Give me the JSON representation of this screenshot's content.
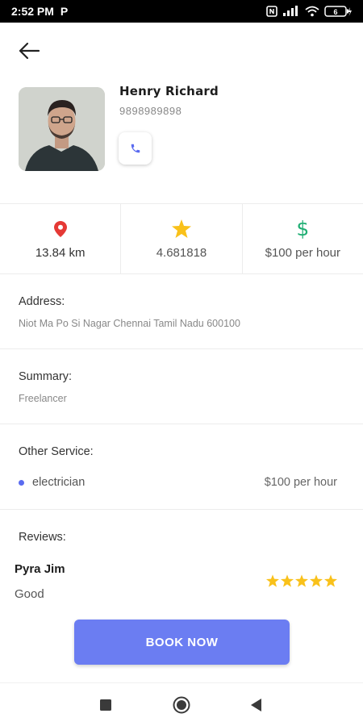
{
  "status_bar": {
    "time": "2:52 PM",
    "app_indicator": "P",
    "icons": [
      "nfc-icon",
      "signal-icon",
      "wifi-icon",
      "battery-icon"
    ],
    "battery_level": "6"
  },
  "header": {
    "back_icon": "arrow-left-icon"
  },
  "provider": {
    "name": "Henry Richard",
    "phone": "9898989898",
    "call_icon": "phone-icon"
  },
  "stats": {
    "distance": "13.84 km",
    "rating": "4.681818",
    "price": "$100 per hour",
    "distance_icon": "location-pin-icon",
    "rating_icon": "star-icon",
    "price_icon": "dollar-icon",
    "colors": {
      "location": "#e53935",
      "star": "#f9c11a",
      "dollar": "#1fae73"
    }
  },
  "address": {
    "title": "Address:",
    "value": "Niot Ma Po Si Nagar Chennai Tamil Nadu 600100"
  },
  "summary": {
    "title": "Summary:",
    "value": "Freelancer"
  },
  "other_service": {
    "title": "Other Service:",
    "items": [
      {
        "name": "electrician",
        "price": "$100 per hour"
      }
    ]
  },
  "reviews": {
    "title": "Reviews:",
    "items": [
      {
        "author": "Pyra Jim",
        "text": "Good",
        "stars": 5
      }
    ]
  },
  "cta": {
    "label": "BOOK NOW",
    "color": "#6b7df2"
  },
  "nav_bar": {
    "icons": [
      "recents-square-icon",
      "home-circle-icon",
      "back-triangle-icon"
    ]
  }
}
